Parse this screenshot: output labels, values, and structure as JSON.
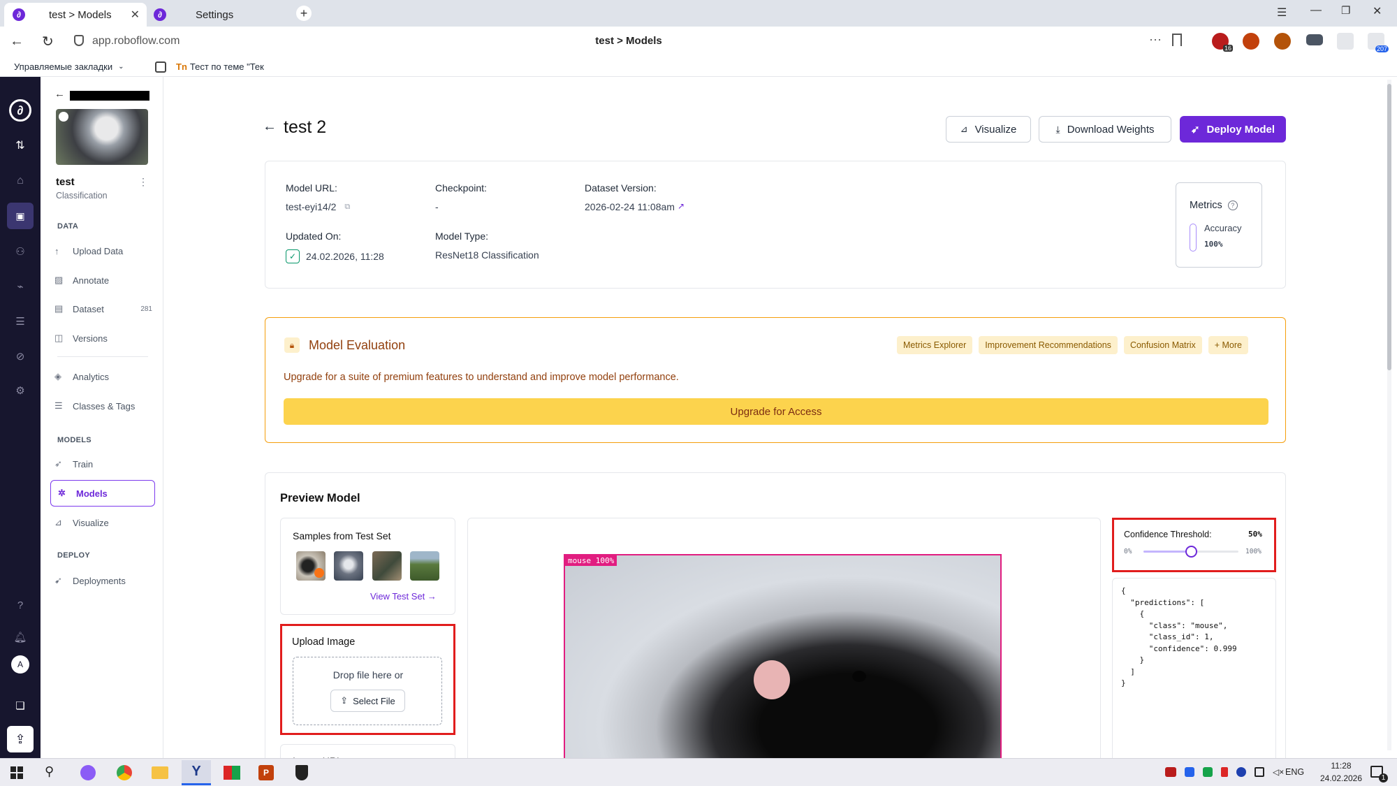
{
  "browser": {
    "tabs": [
      {
        "label": "test > Models",
        "active": true
      },
      {
        "label": "Settings",
        "active": false
      }
    ],
    "url": "app.roboflow.com",
    "page_title": "test > Models",
    "bookmarks": [
      {
        "label": "Управляемые закладки"
      },
      {
        "label": "Тест по теме \"Тек"
      }
    ],
    "extension_badges": {
      "first": "16",
      "last": "207"
    }
  },
  "project": {
    "name": "test",
    "type": "Classification"
  },
  "sidebar": {
    "sections": [
      {
        "title": "DATA",
        "items": [
          {
            "label": "Upload Data",
            "icon": "upload-arrow-icon"
          },
          {
            "label": "Annotate",
            "icon": "annotate-icon"
          },
          {
            "label": "Dataset",
            "icon": "dataset-icon",
            "count": "281"
          },
          {
            "label": "Versions",
            "icon": "versions-icon"
          },
          {
            "label": "Analytics",
            "icon": "analytics-icon"
          },
          {
            "label": "Classes & Tags",
            "icon": "list-icon"
          }
        ]
      },
      {
        "title": "MODELS",
        "items": [
          {
            "label": "Train",
            "icon": "train-icon"
          },
          {
            "label": "Models",
            "icon": "models-icon",
            "active": true
          },
          {
            "label": "Visualize",
            "icon": "chart-icon"
          }
        ]
      },
      {
        "title": "DEPLOY",
        "items": [
          {
            "label": "Deployments",
            "icon": "rocket-icon"
          }
        ]
      }
    ],
    "avatar_letter": "A"
  },
  "header": {
    "title": "test 2",
    "visualize_label": "Visualize",
    "download_label": "Download Weights",
    "deploy_label": "Deploy Model"
  },
  "model_info": {
    "model_url_label": "Model URL:",
    "model_url": "test-eyi14/2",
    "checkpoint_label": "Checkpoint:",
    "checkpoint": "-",
    "dataset_version_label": "Dataset Version:",
    "dataset_version": "2026-02-24 11:08am",
    "updated_on_label": "Updated On:",
    "updated_on": "24.02.2026, 11:28",
    "model_type_label": "Model Type:",
    "model_type": "ResNet18 Classification",
    "metrics_title": "Metrics",
    "metrics": [
      {
        "name": "Accuracy",
        "value": "100%"
      }
    ]
  },
  "evaluation": {
    "title": "Model Evaluation",
    "description": "Upgrade for a suite of premium features to understand and improve model performance.",
    "chips": [
      "Metrics Explorer",
      "Improvement Recommendations",
      "Confusion Matrix",
      "+ More"
    ],
    "upgrade_label": "Upgrade for Access"
  },
  "preview": {
    "title": "Preview Model",
    "samples_title": "Samples from Test Set",
    "view_test_set": "View Test Set →",
    "upload_title": "Upload Image",
    "drop_text": "Drop file here or",
    "select_file": "Select File",
    "image_url_title": "Image URL",
    "prediction_label": "mouse 100%",
    "threshold": {
      "label": "Confidence Threshold:",
      "value": "50%",
      "min_label": "0%",
      "max_label": "100%",
      "fraction": 0.5
    },
    "json_output": "{\n  \"predictions\": [\n    {\n      \"class\": \"mouse\",\n      \"class_id\": 1,\n      \"confidence\": 0.999\n    }\n  ]\n}"
  },
  "taskbar": {
    "lang": "ENG",
    "time": "11:28",
    "date": "24.02.2026",
    "notification_count": "1"
  },
  "colors": {
    "primary": "#6d28d9",
    "eval_border": "#f59e0b",
    "eval_title": "#92400e",
    "upgrade_bar": "#fcd34d",
    "highlight_red": "#e11d1d",
    "rail_bg": "#17162e"
  }
}
